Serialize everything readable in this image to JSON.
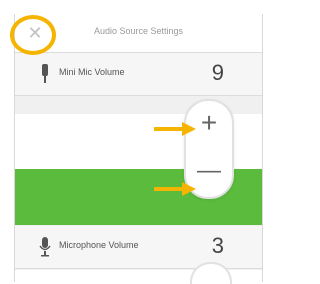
{
  "window": {
    "title": "Audio Source Settings",
    "close_icon": "close-icon"
  },
  "rows": [
    {
      "label": "Mini Mic Volume",
      "value": "9",
      "icon": "mini-mic-icon"
    },
    {
      "label": "Microphone Volume",
      "value": "3",
      "icon": "microphone-icon"
    }
  ],
  "stepper": {
    "increment": "+",
    "decrement": "—"
  },
  "colors": {
    "highlight_band": "#5bbb3d",
    "annotation": "#f5b400"
  }
}
